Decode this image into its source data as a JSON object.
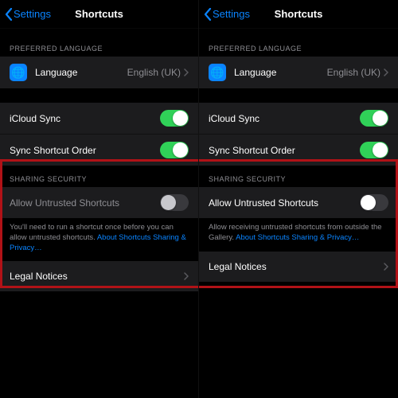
{
  "nav": {
    "back": "Settings",
    "title": "Shortcuts"
  },
  "sections": {
    "preferred_language": "PREFERRED LANGUAGE",
    "language_label": "Language",
    "language_value": "English (UK)",
    "icloud_sync": "iCloud Sync",
    "sync_order": "Sync Shortcut Order",
    "sharing_security": "SHARING SECURITY",
    "allow_untrusted": "Allow Untrusted Shortcuts",
    "legal_notices": "Legal Notices"
  },
  "left_footer": {
    "text": "You'll need to run a shortcut once before you can allow untrusted shortcuts. ",
    "link": "About Shortcuts Sharing & Privacy…"
  },
  "right_footer": {
    "text": "Allow receiving untrusted shortcuts from outside the Gallery. ",
    "link": "About Shortcuts Sharing & Privacy…"
  },
  "icons": {
    "globe": "🌐"
  }
}
